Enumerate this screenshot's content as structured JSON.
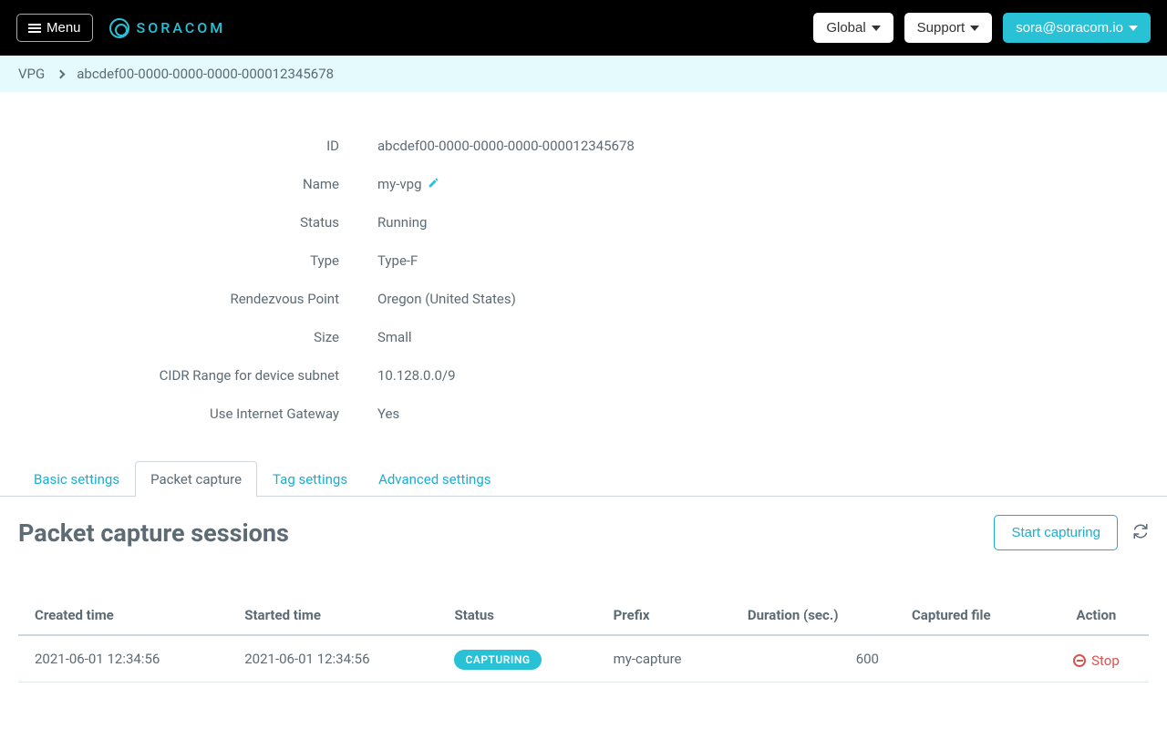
{
  "header": {
    "menu_label": "Menu",
    "logo_text": "SORACOM",
    "global_label": "Global",
    "support_label": "Support",
    "user_email": "sora@soracom.io"
  },
  "breadcrumb": {
    "root": "VPG",
    "current": "abcdef00-0000-0000-0000-000012345678"
  },
  "details": {
    "rows": [
      {
        "label": "ID",
        "value": "abcdef00-0000-0000-0000-000012345678",
        "editable": false
      },
      {
        "label": "Name",
        "value": "my-vpg",
        "editable": true
      },
      {
        "label": "Status",
        "value": "Running",
        "editable": false
      },
      {
        "label": "Type",
        "value": "Type-F",
        "editable": false
      },
      {
        "label": "Rendezvous Point",
        "value": "Oregon (United States)",
        "editable": false
      },
      {
        "label": "Size",
        "value": "Small",
        "editable": false
      },
      {
        "label": "CIDR Range for device subnet",
        "value": "10.128.0.0/9",
        "editable": false
      },
      {
        "label": "Use Internet Gateway",
        "value": "Yes",
        "editable": false
      }
    ]
  },
  "tabs": [
    {
      "label": "Basic settings",
      "active": false
    },
    {
      "label": "Packet capture",
      "active": true
    },
    {
      "label": "Tag settings",
      "active": false
    },
    {
      "label": "Advanced settings",
      "active": false
    }
  ],
  "sessions": {
    "title": "Packet capture sessions",
    "start_label": "Start capturing",
    "columns": {
      "created": "Created time",
      "started": "Started time",
      "status": "Status",
      "prefix": "Prefix",
      "duration": "Duration (sec.)",
      "file": "Captured file",
      "action": "Action"
    },
    "rows": [
      {
        "created": "2021-06-01 12:34:56",
        "started": "2021-06-01 12:34:56",
        "status": "CAPTURING",
        "prefix": "my-capture",
        "duration": "600",
        "file": "",
        "action_label": "Stop"
      }
    ]
  }
}
